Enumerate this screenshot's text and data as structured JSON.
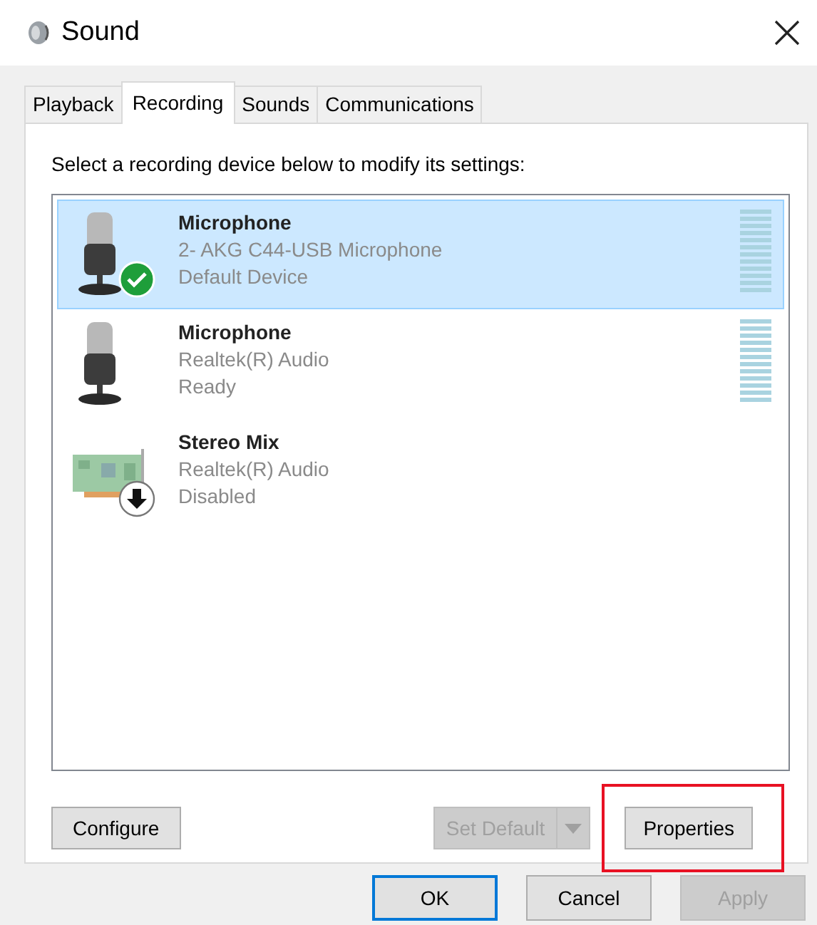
{
  "window": {
    "title": "Sound"
  },
  "tabs": [
    {
      "label": "Playback",
      "selected": false
    },
    {
      "label": "Recording",
      "selected": true
    },
    {
      "label": "Sounds",
      "selected": false
    },
    {
      "label": "Communications",
      "selected": false
    }
  ],
  "instruction": "Select a recording device below to modify its settings:",
  "devices": [
    {
      "name": "Microphone",
      "detail": "2- AKG C44-USB Microphone",
      "status": "Default Device",
      "kind": "microphone",
      "is_default": true,
      "disabled": false,
      "selected": true,
      "meter": true
    },
    {
      "name": "Microphone",
      "detail": "Realtek(R) Audio",
      "status": "Ready",
      "kind": "microphone",
      "is_default": false,
      "disabled": false,
      "selected": false,
      "meter": true
    },
    {
      "name": "Stereo Mix",
      "detail": "Realtek(R) Audio",
      "status": "Disabled",
      "kind": "card",
      "is_default": false,
      "disabled": true,
      "selected": false,
      "meter": false
    }
  ],
  "panel_buttons": [
    {
      "label": "Configure",
      "kind": "button",
      "disabled": false,
      "highlighted": false
    },
    {
      "label": "Set Default",
      "kind": "split",
      "disabled": true,
      "highlighted": false
    },
    {
      "label": "Properties",
      "kind": "button",
      "disabled": false,
      "highlighted": true
    }
  ],
  "dialog_buttons": [
    {
      "label": "OK",
      "default": true,
      "disabled": false
    },
    {
      "label": "Cancel",
      "default": false,
      "disabled": false
    },
    {
      "label": "Apply",
      "default": false,
      "disabled": true
    }
  ]
}
